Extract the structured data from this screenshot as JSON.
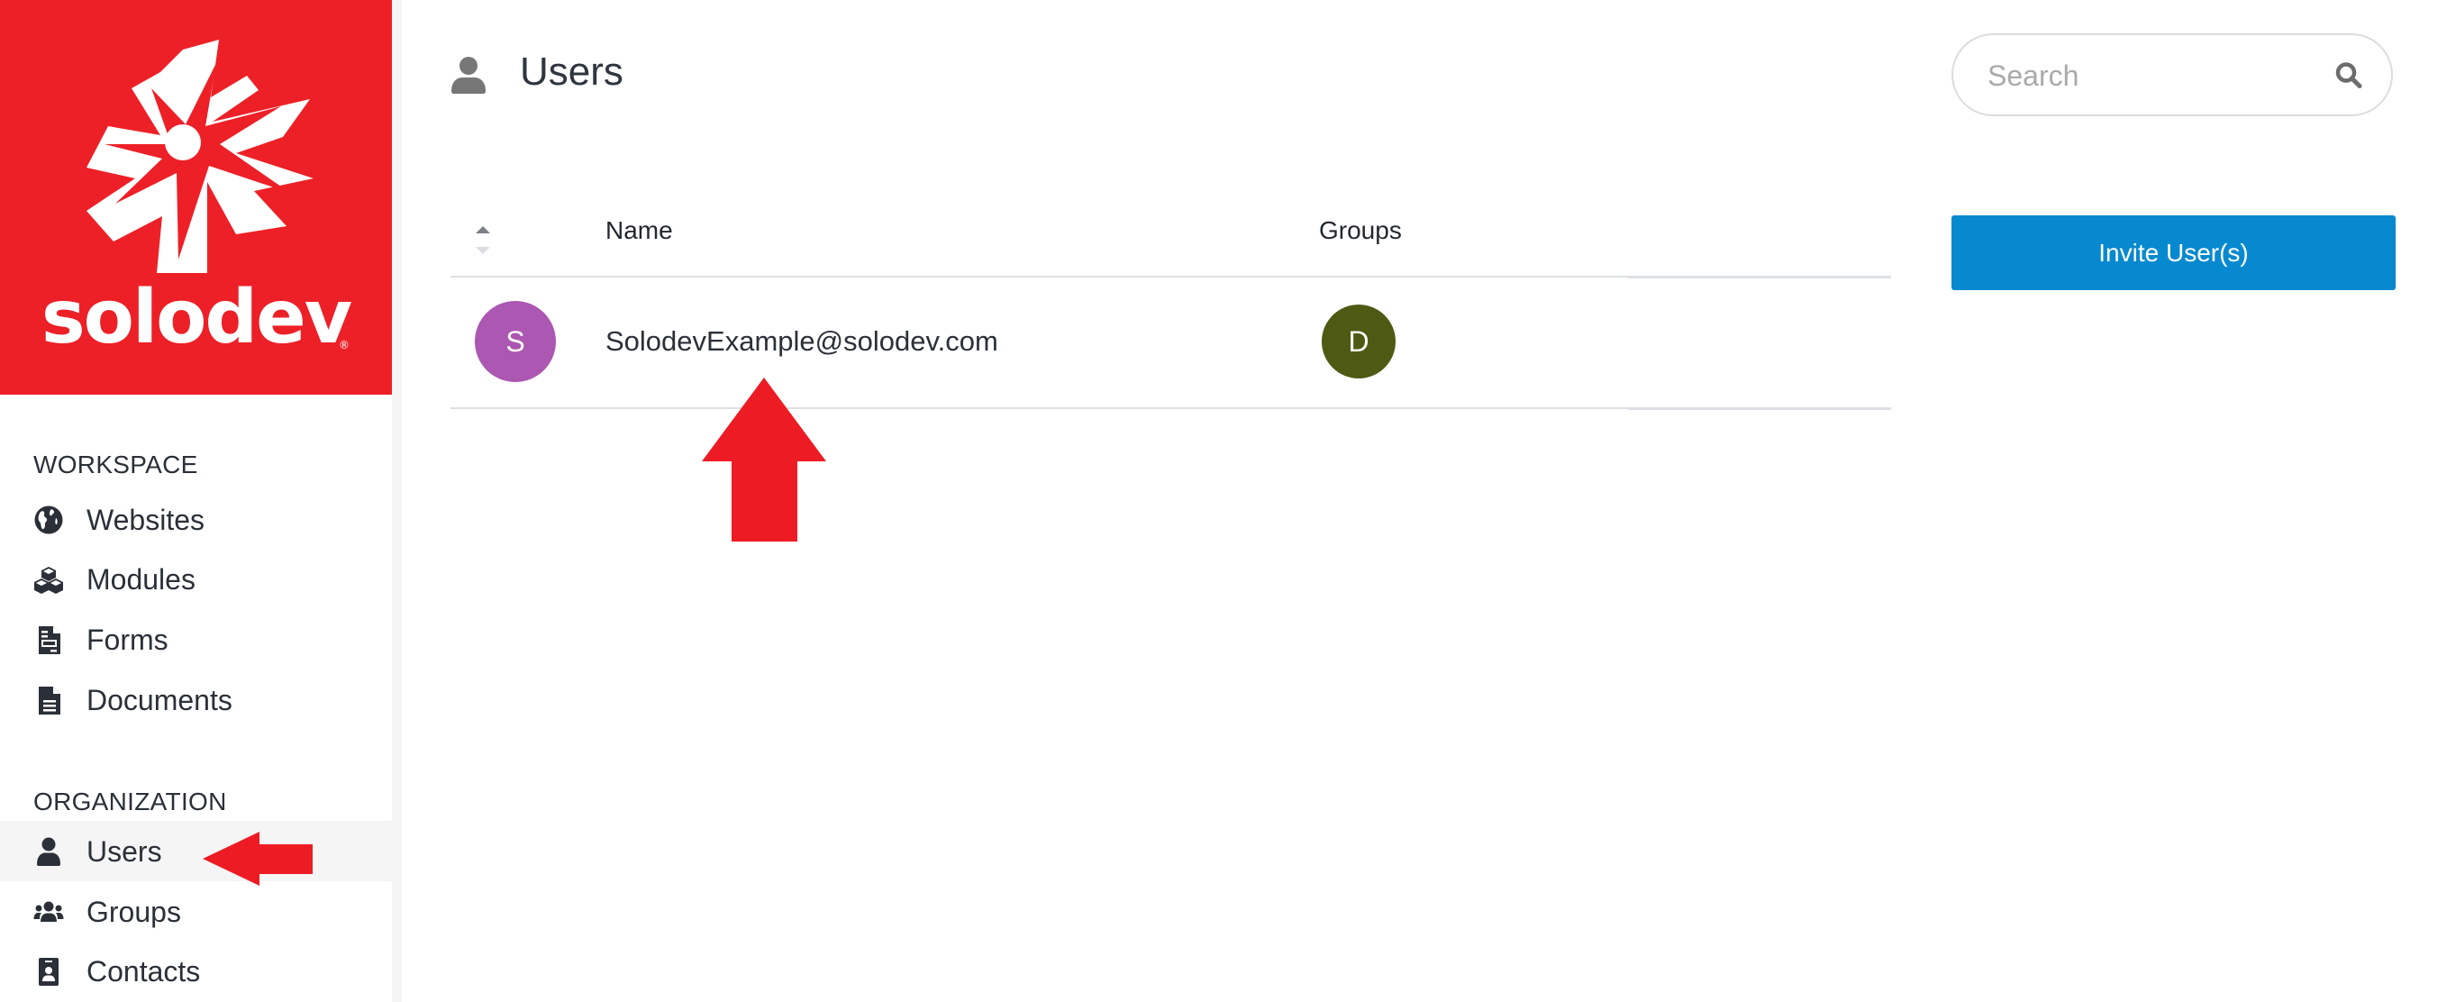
{
  "brand": {
    "name": "solodev",
    "registered_mark": "®",
    "color": "#ed2027"
  },
  "sidebar": {
    "sections": [
      {
        "label": "WORKSPACE",
        "items": [
          {
            "label": "Websites",
            "icon": "globe-icon"
          },
          {
            "label": "Modules",
            "icon": "cubes-icon"
          },
          {
            "label": "Forms",
            "icon": "form-document-icon"
          },
          {
            "label": "Documents",
            "icon": "document-icon"
          }
        ]
      },
      {
        "label": "ORGANIZATION",
        "items": [
          {
            "label": "Users",
            "icon": "user-icon",
            "active": true
          },
          {
            "label": "Groups",
            "icon": "users-group-icon"
          },
          {
            "label": "Contacts",
            "icon": "id-badge-icon"
          }
        ]
      }
    ]
  },
  "header": {
    "title": "Users",
    "icon": "user-icon"
  },
  "search": {
    "placeholder": "Search",
    "value": "",
    "icon": "search-icon"
  },
  "actions": {
    "invite_label": "Invite User(s)",
    "invite_color": "#0789d0"
  },
  "table": {
    "columns": [
      "Name",
      "Groups"
    ],
    "sort": {
      "column": "Name",
      "direction": "ascending"
    },
    "rows": [
      {
        "avatar_initial": "S",
        "avatar_color": "#ac57b1",
        "name": "SolodevExample@solodev.com",
        "groups": [
          {
            "initial": "D",
            "color": "#4e5a14"
          }
        ]
      }
    ]
  },
  "annotations": [
    {
      "type": "arrow",
      "direction": "up",
      "points_to": "user-email",
      "color": "#ed1c24"
    },
    {
      "type": "arrow",
      "direction": "left",
      "points_to": "sidebar-item-users",
      "color": "#ed1c24"
    }
  ]
}
